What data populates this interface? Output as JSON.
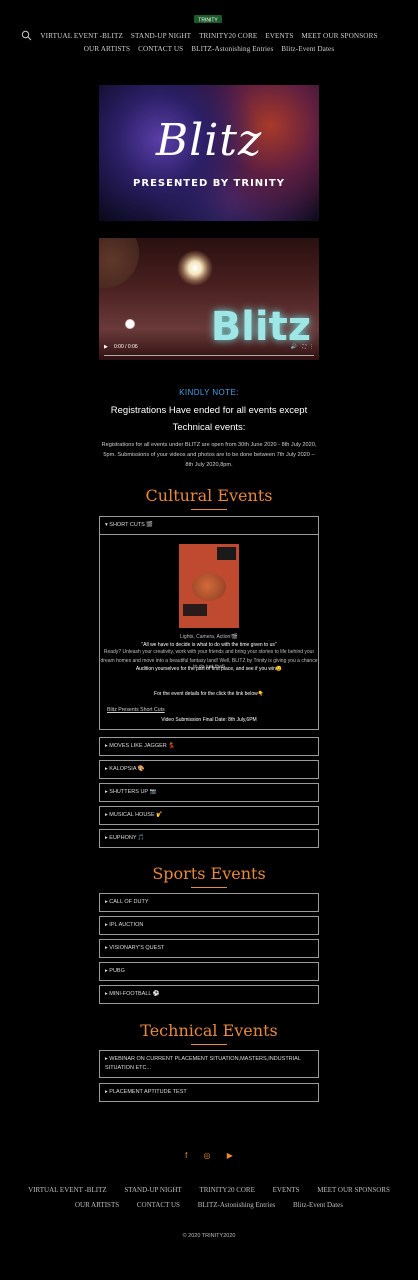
{
  "header": {
    "logo_text": "TRINITY",
    "nav_row1": [
      "VIRTUAL EVENT -BLITZ",
      "STAND-UP NIGHT",
      "TRINITY20 CORE",
      "EVENTS",
      "MEET OUR SPONSORS"
    ],
    "nav_row2": [
      "OUR ARTISTS",
      "CONTACT US",
      "BLITZ-Astonishing Entries",
      "Blitz-Event Dates"
    ]
  },
  "banner": {
    "title": "Blitz",
    "subtitle": "PRESENTED BY TRINITY"
  },
  "video": {
    "overlay_title": "Blitz",
    "time": "0:00 / 0:06"
  },
  "notice": {
    "heading": "KINDLY NOTE:",
    "line1": "Registrations Have ended for all events except",
    "line2": "Technical events:",
    "body": "Registrations for all events under BLITZ are open from 30th June 2020 - 8th July 2020, 5pm. Submissions of your videos and photos are to be done between 7th July 2020 – 8th July 2020,8pm."
  },
  "cultural": {
    "title": "Cultural Events",
    "open_item": "SHORT CUTS 🎬",
    "panel": {
      "line1": "Lights, Camera, Action!🎬",
      "line2": "\"All we have to decide is what to do with the time given to us\"",
      "line3": "Ready? Unleash your creativity, work with your friends and bring your stories to life behind your",
      "line4": "dream homes and move into a beautiful fantasy land! Well, BLITZ by Trinity is giving you a chance to do just that!",
      "line5": "Audition yourselves for the part of first place, and see if you win😉",
      "line6": "For the event details for the click the link below👇",
      "link": "Blitz Presents Short Cuts",
      "deadline": "Video Submission Final Date: 8th July,6PM"
    },
    "items": [
      "MOVES LIKE JAGGER 💃",
      "KALOPSIA 🎨",
      "SHUTTERS UP 📷",
      "MUSICAL HOUSE 🎷",
      "EUPHONY 🎵"
    ]
  },
  "sports": {
    "title": "Sports Events",
    "items": [
      "CALL OF DUTY",
      "IPL AUCTION",
      "VISIONARY'S QUEST",
      "PUBG",
      "MINI-FOOTBALL ⚽"
    ]
  },
  "technical": {
    "title": "Technical Events",
    "items": [
      "WEBINAR ON CURRENT PLACEMENT SITUATION,MASTERS,INDUSTRIAL SITUATION ETC...",
      "PLACEMENT APTITUDE TEST"
    ]
  },
  "footer": {
    "social_icons": [
      "facebook-icon",
      "instagram-icon",
      "youtube-icon"
    ],
    "nav_row1": [
      "VIRTUAL EVENT -BLITZ",
      "STAND-UP NIGHT",
      "TRINITY20 CORE",
      "EVENTS",
      "MEET OUR SPONSORS"
    ],
    "nav_row2": [
      "OUR ARTISTS",
      "CONTACT US",
      "BLITZ-Astonishing Entries",
      "Blitz-Event Dates"
    ],
    "copyright": "© 2020 TRINITY2020"
  },
  "colors": {
    "accent": "#e8893a",
    "note_blue": "#3fa0e8",
    "background": "#000000"
  }
}
